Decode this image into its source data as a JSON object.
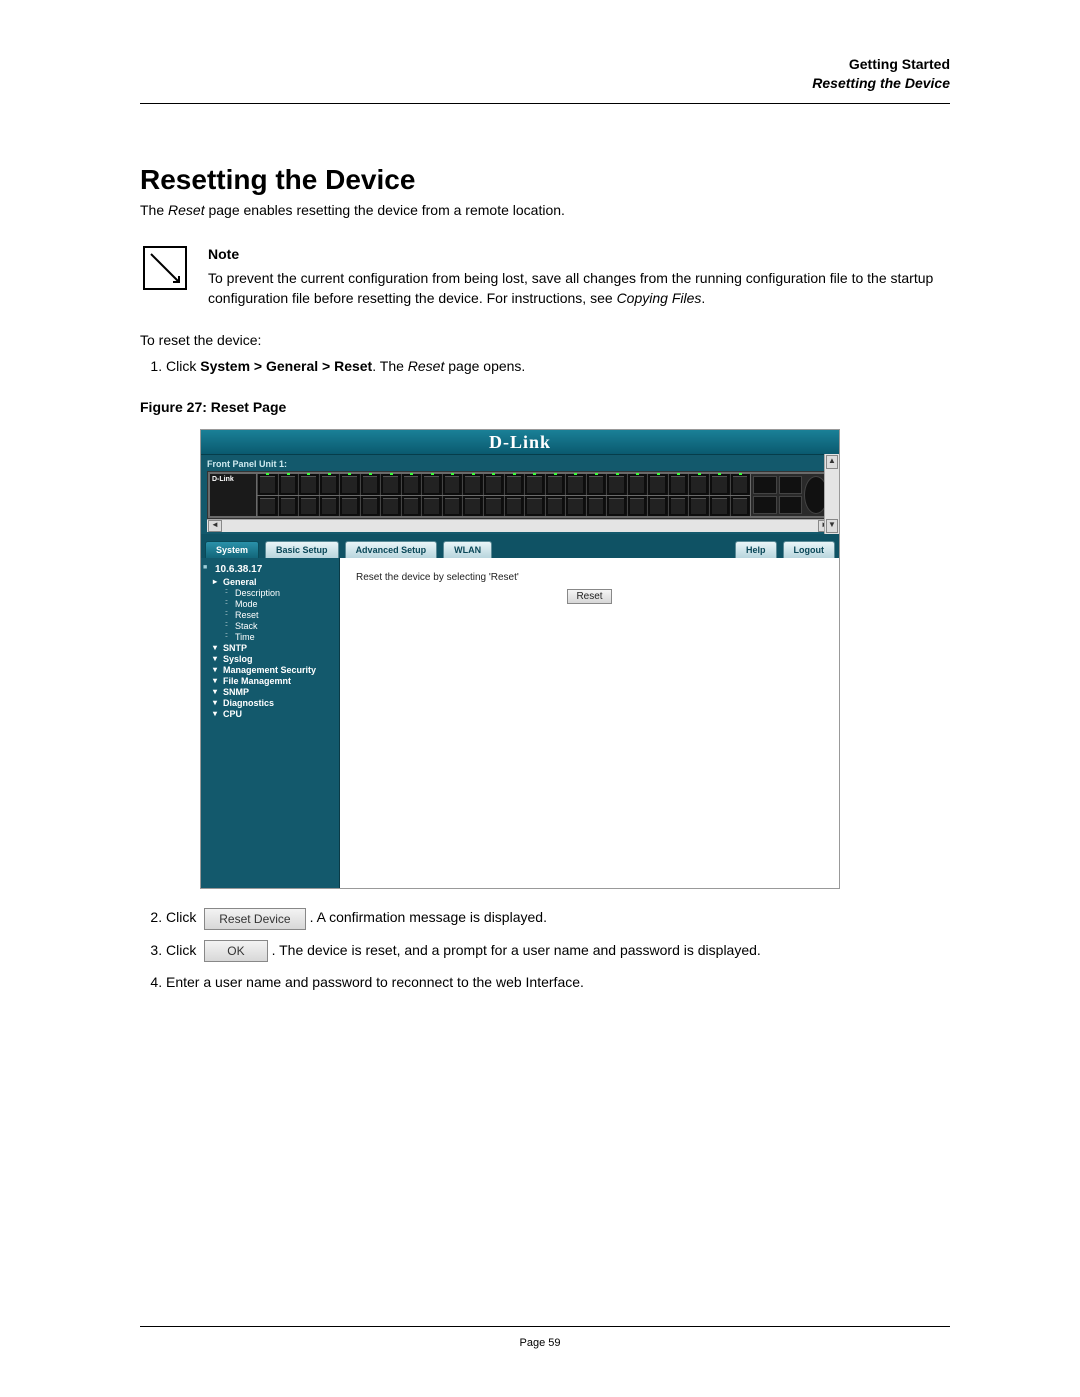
{
  "header": {
    "chapter": "Getting Started",
    "section": "Resetting the Device"
  },
  "title": "Resetting the Device",
  "intro_pre": "The ",
  "intro_ital": "Reset",
  "intro_post": " page enables resetting the device from a remote location.",
  "note": {
    "title": "Note",
    "body_a": "To prevent the current configuration from being lost, save all changes from the running configuration file to the startup configuration file before resetting the device. For instructions, see ",
    "body_ital": "Copying Files",
    "body_b": "."
  },
  "instr_lead": "To reset the device:",
  "step1": {
    "pre": "Click ",
    "bold": "System > General > Reset",
    "mid": ". The ",
    "ital": "Reset",
    "post": " page opens."
  },
  "figure_label": "Figure 27:  Reset Page",
  "figure_ui": {
    "brand": "D-Link",
    "front_panel_title": "Front Panel Unit 1:",
    "label_pad_brand": "D-Link",
    "tabs": {
      "system": "System",
      "basic": "Basic Setup",
      "advanced": "Advanced Setup",
      "wlan": "WLAN",
      "help": "Help",
      "logout": "Logout"
    },
    "sidebar": {
      "root": "10.6.38.17",
      "general": "General",
      "general_children": {
        "description": "Description",
        "mode": "Mode",
        "reset": "Reset",
        "stack": "Stack",
        "time": "Time"
      },
      "items": {
        "sntp": "SNTP",
        "syslog": "Syslog",
        "mgmt_sec": "Management Security",
        "file_mgmt": "File Managemnt",
        "snmp": "SNMP",
        "diagnostics": "Diagnostics",
        "cpu": "CPU"
      }
    },
    "content_text": "Reset the device by selecting 'Reset'",
    "reset_button": "Reset"
  },
  "step2": {
    "pre": "Click ",
    "btn": "Reset Device",
    "post": ". A confirmation message is displayed."
  },
  "step3": {
    "pre": "Click ",
    "btn": "OK",
    "post": ". The device is reset, and a prompt for a user name and password is displayed."
  },
  "step4": "Enter a user name and password to reconnect to the web Interface.",
  "page_number": "Page 59"
}
